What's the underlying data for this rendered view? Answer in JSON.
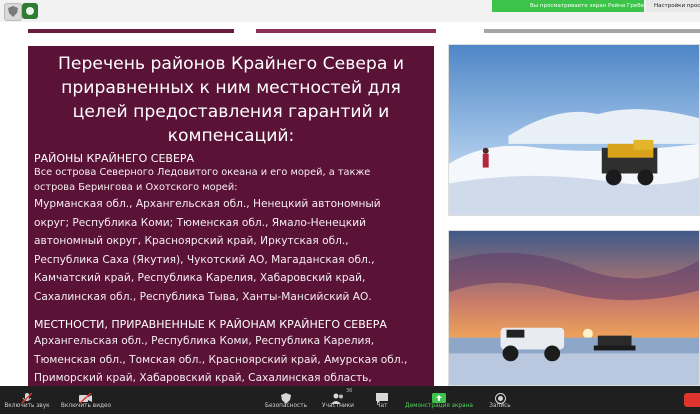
{
  "window": {
    "share_banner": "Вы просматриваете экран Рейна Гребенка",
    "view_options": "Настройки просм"
  },
  "slide": {
    "title_lines": [
      "Перечень районов Крайнего Севера и",
      "приравненных к ним местностей для",
      "целей предоставления гарантий и",
      "компенсаций:"
    ],
    "section1_heading": "РАЙОНЫ КРАЙНЕГО СЕВЕРА",
    "section1_lines": [
      "Все острова Северного Ледовитого океана и его морей,  а  также",
      "острова Берингова и Охотского морей:"
    ],
    "section1_list": [
      "Мурманская обл., Архангельская обл., Ненецкий автономный",
      "округ; Республика Коми; Тюменская обл., Ямало-Ненецкий",
      "автономный округ, Красноярский край, Иркутская обл.,",
      "Республика Саха (Якутия), Чукотский АО, Магаданская обл.,",
      "Камчатский край, Республика Карелия, Хабаровский край,",
      "Сахалинская обл., Республика Тыва, Ханты-Мансийский АО."
    ],
    "section2_heading": "МЕСТНОСТИ, ПРИРАВНЕННЫЕ К РАЙОНАМ КРАЙНЕГО СЕВЕРА",
    "section2_list": [
      "Архангельская обл., Республика Коми, Республика Карелия,",
      "Тюменская обл., Томская обл., Красноярский край, Амурская обл.,",
      "Приморский край, Хабаровский край, Сахалинская область,"
    ]
  },
  "toolbar": {
    "mic_label": "Включить звук",
    "video_label": "Включить видео",
    "security_label": "Безопасность",
    "participants_label": "Участники",
    "participants_count": "36",
    "chat_label": "Чат",
    "share_label": "Демонстрация экрана",
    "record_label": "Запись"
  },
  "colors": {
    "panel": "#5a1236",
    "accent_stripe": "#6b1d41",
    "share_green": "#3cc34a",
    "toolbar_bg": "#1f1f1f",
    "end_red": "#e0352f"
  }
}
